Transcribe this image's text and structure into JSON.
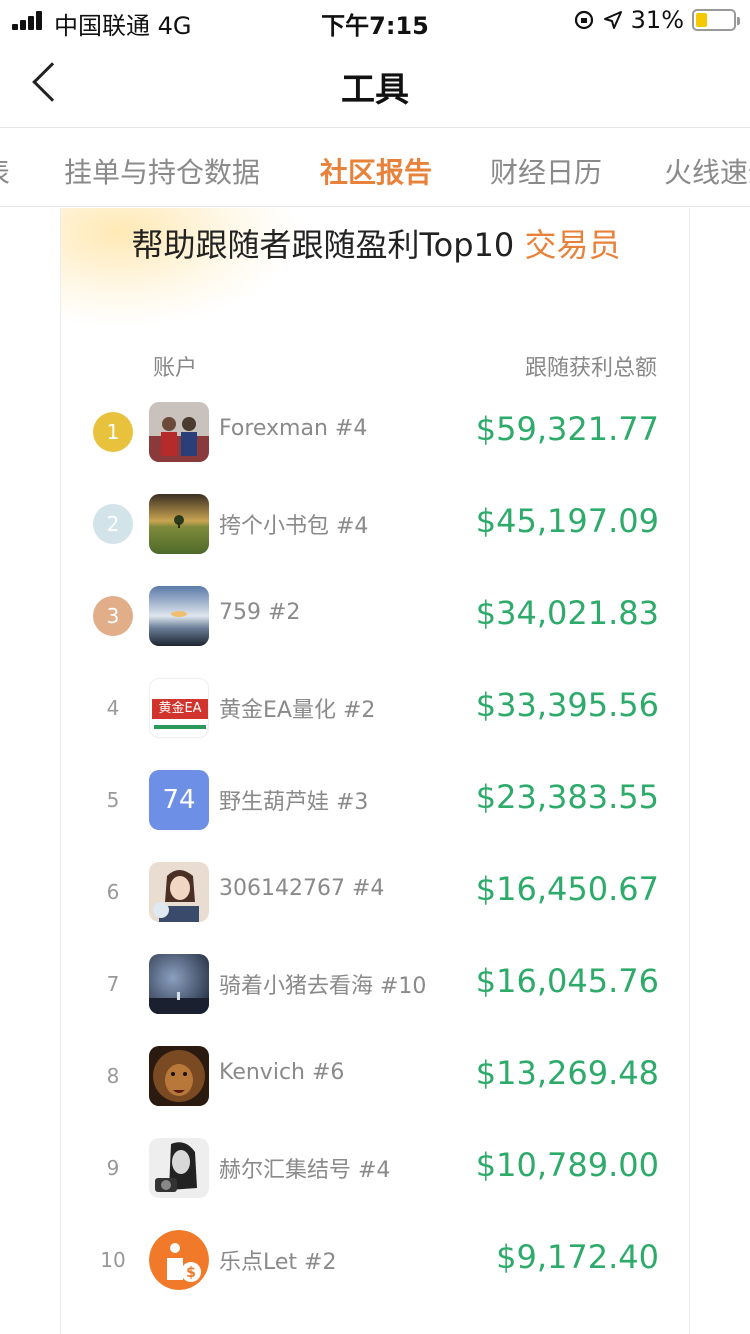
{
  "status_bar": {
    "carrier": "中国联通 4G",
    "time": "下午7:15",
    "battery": "31%",
    "battery_fraction": 0.31
  },
  "nav": {
    "title": "工具",
    "back_icon": "chevron-left-icon"
  },
  "tabs": [
    {
      "label": "挂单与持仓数据",
      "active": false
    },
    {
      "label": "社区报告",
      "active": true
    },
    {
      "label": "财经日历",
      "active": false
    },
    {
      "label": "火线速递",
      "active": false
    }
  ],
  "report": {
    "title_main": "帮助跟随者跟随盈利Top10 ",
    "title_highlight": "交易员",
    "col_account": "账户",
    "col_profit": "跟随获利总额",
    "rows": [
      {
        "rank": "1",
        "name": "Forexman #4",
        "profit": "$59,321.77",
        "avatar": "group-photo"
      },
      {
        "rank": "2",
        "name": "挎个小书包 #4",
        "profit": "$45,197.09",
        "avatar": "landscape-tree"
      },
      {
        "rank": "3",
        "name": "759 #2",
        "profit": "$34,021.83",
        "avatar": "sunset-sea"
      },
      {
        "rank": "4",
        "name": "黄金EA量化 #2",
        "profit": "$33,395.56",
        "avatar": "gold-ea-logo",
        "avatar_text": "黄金EA"
      },
      {
        "rank": "5",
        "name": "野生葫芦娃 #3",
        "profit": "$23,383.55",
        "avatar": "number-badge",
        "avatar_text": "74"
      },
      {
        "rank": "6",
        "name": "306142767 #4",
        "profit": "$16,450.67",
        "avatar": "portrait"
      },
      {
        "rank": "7",
        "name": "骑着小猪去看海 #10",
        "profit": "$16,045.76",
        "avatar": "night-sky"
      },
      {
        "rank": "8",
        "name": "Kenvich #6",
        "profit": "$13,269.48",
        "avatar": "lion"
      },
      {
        "rank": "9",
        "name": "赫尔汇集结号 #4",
        "profit": "$10,789.00",
        "avatar": "bw-portrait"
      },
      {
        "rank": "10",
        "name": "乐点Let #2",
        "profit": "$9,172.40",
        "avatar": "ledian-logo"
      }
    ]
  },
  "colors": {
    "accent": "#e8823a",
    "profit_green": "#2eab6a",
    "rank_gold": "#e8c23c",
    "rank_silver": "#d2e3ea",
    "rank_bronze": "#e2ae8a"
  }
}
